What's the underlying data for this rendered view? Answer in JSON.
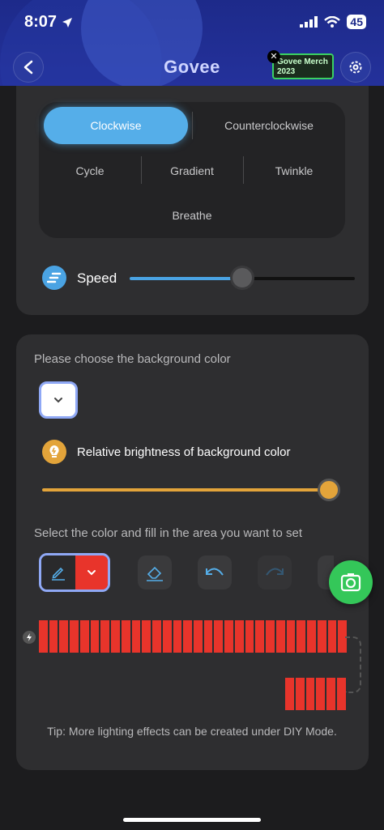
{
  "status": {
    "time": "8:07",
    "battery": "45"
  },
  "header": {
    "brand": "Govee",
    "merch_line1": "Govee Merch",
    "merch_line2": "2023"
  },
  "modes": {
    "active": "Clockwise",
    "items": [
      "Counterclockwise",
      "Cycle",
      "Gradient",
      "Twinkle",
      "Breathe"
    ]
  },
  "speed": {
    "label": "Speed",
    "value_fraction": 0.5
  },
  "background": {
    "prompt": "Please choose the background color",
    "brightness_label": "Relative brightness of background color",
    "brightness_fraction": 1.0
  },
  "fill": {
    "prompt": "Select the color and fill in the area you want to set",
    "selected_color": "#e8342b"
  },
  "strip": {
    "segments_row1": 30,
    "segments_row2": 6,
    "color": "#e8342b"
  },
  "tip": "Tip: More lighting effects can be created under DIY Mode.",
  "colors": {
    "accent_blue": "#55aee9",
    "brightness_orange": "#e3a43a",
    "snap_green": "#34c759"
  }
}
